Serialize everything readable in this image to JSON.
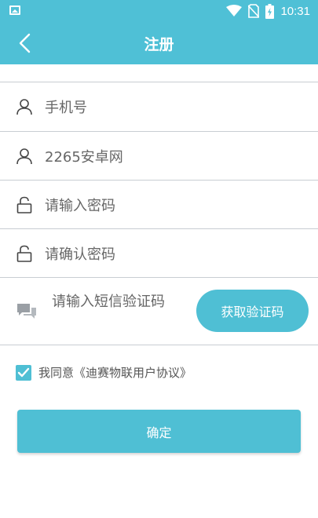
{
  "status_bar": {
    "time": "10:31"
  },
  "header": {
    "title": "注册"
  },
  "form": {
    "phone_placeholder": "手机号",
    "username_value": "2265安卓网",
    "password_placeholder": "请输入密码",
    "confirm_password_placeholder": "请确认密码",
    "sms_code_placeholder": "请输入短信验证码",
    "get_code_label": "获取验证码"
  },
  "agreement": {
    "checked": true,
    "text": "我同意《迪赛物联用户协议》"
  },
  "confirm_label": "确定",
  "colors": {
    "accent": "#4fc0d6",
    "divider": "#c8cdd2",
    "placeholder": "#666666"
  }
}
